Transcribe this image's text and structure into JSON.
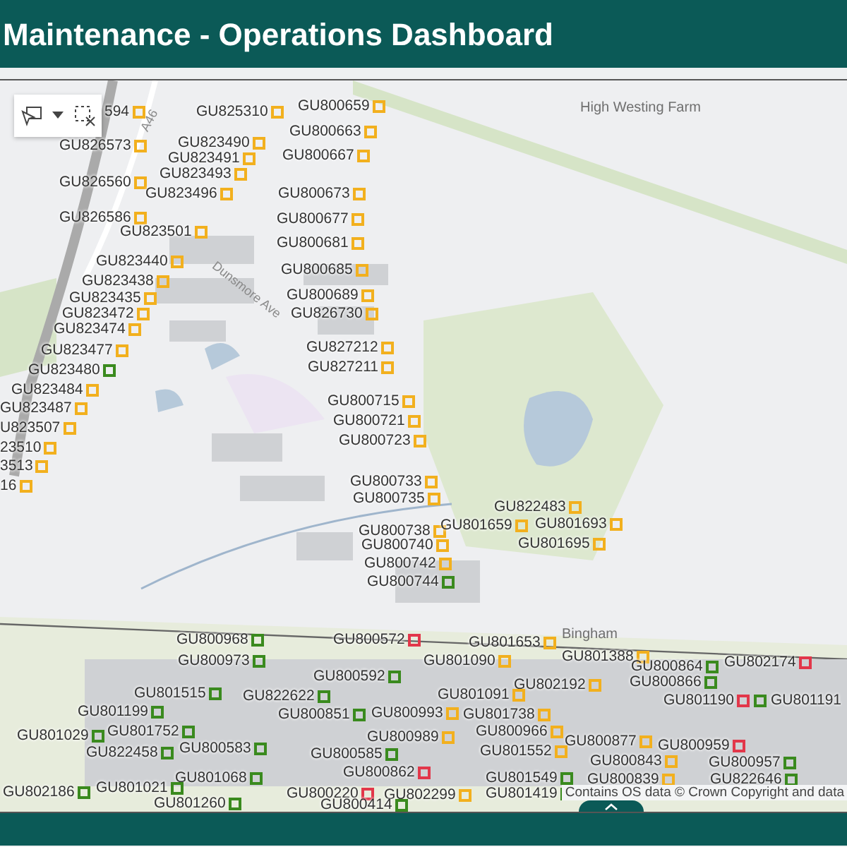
{
  "header": {
    "title": "Maintenance - Operations Dashboard"
  },
  "map": {
    "place_labels": [
      {
        "kind": "road",
        "text": "A46"
      },
      {
        "kind": "road",
        "text": "Dunsmore Ave"
      },
      {
        "kind": "place",
        "text": "High Westing Farm"
      },
      {
        "kind": "place",
        "text": "Bingham"
      }
    ],
    "labels": [
      {
        "text": "594",
        "color": "#f2b01e"
      },
      {
        "text": "GU825310",
        "color": "#f2b01e"
      },
      {
        "text": "GU800659",
        "color": "#f2b01e"
      },
      {
        "text": "GU826573",
        "color": "#f2b01e"
      },
      {
        "text": "GU823490",
        "color": "#f2b01e"
      },
      {
        "text": "GU800663",
        "color": "#f2b01e"
      },
      {
        "text": "GU823491",
        "color": "#f2b01e"
      },
      {
        "text": "GU800667",
        "color": "#f2b01e"
      },
      {
        "text": "GU823493",
        "color": "#f2b01e"
      },
      {
        "text": "GU826560",
        "color": "#f2b01e"
      },
      {
        "text": "GU823496",
        "color": "#f2b01e"
      },
      {
        "text": "GU800673",
        "color": "#f2b01e"
      },
      {
        "text": "GU826586",
        "color": "#f2b01e"
      },
      {
        "text": "GU800677",
        "color": "#f2b01e"
      },
      {
        "text": "GU823501",
        "color": "#f2b01e"
      },
      {
        "text": "GU800681",
        "color": "#f2b01e"
      },
      {
        "text": "GU823440",
        "color": "#f2b01e"
      },
      {
        "text": "GU800685",
        "color": "#f2b01e"
      },
      {
        "text": "GU823438",
        "color": "#f2b01e"
      },
      {
        "text": "GU823435",
        "color": "#f2b01e"
      },
      {
        "text": "GU800689",
        "color": "#f2b01e"
      },
      {
        "text": "GU823472",
        "color": "#f2b01e"
      },
      {
        "text": "GU826730",
        "color": "#f2b01e"
      },
      {
        "text": "GU823474",
        "color": "#f2b01e"
      },
      {
        "text": "GU827212",
        "color": "#f2b01e"
      },
      {
        "text": "GU823477",
        "color": "#f2b01e"
      },
      {
        "text": "GU823480",
        "color": "#3a8a1e"
      },
      {
        "text": "GU827211",
        "color": "#f2b01e"
      },
      {
        "text": "GU823484",
        "color": "#f2b01e"
      },
      {
        "text": "GU800715",
        "color": "#f2b01e"
      },
      {
        "text": "GU823487",
        "color": "#f2b01e"
      },
      {
        "text": "U823507",
        "color": "#f2b01e"
      },
      {
        "text": "GU800721",
        "color": "#f2b01e"
      },
      {
        "text": "23510",
        "color": "#f2b01e"
      },
      {
        "text": "GU800723",
        "color": "#f2b01e"
      },
      {
        "text": "3513",
        "color": "#f2b01e"
      },
      {
        "text": "16",
        "color": "#f2b01e"
      },
      {
        "text": "GU800733",
        "color": "#f2b01e"
      },
      {
        "text": "GU800735",
        "color": "#f2b01e"
      },
      {
        "text": "GU822483",
        "color": "#f2b01e"
      },
      {
        "text": "GU800738",
        "color": "#f2b01e"
      },
      {
        "text": "GU801659",
        "color": "#f2b01e"
      },
      {
        "text": "GU801693",
        "color": "#f2b01e"
      },
      {
        "text": "GU800740",
        "color": "#f2b01e"
      },
      {
        "text": "GU801695",
        "color": "#f2b01e"
      },
      {
        "text": "GU800742",
        "color": "#f2b01e"
      },
      {
        "text": "GU800744",
        "color": "#3a8a1e"
      },
      {
        "text": "GU800968",
        "color": "#3a8a1e"
      },
      {
        "text": "GU800572",
        "color": "#e2374a"
      },
      {
        "text": "GU801653",
        "color": "#f2b01e"
      },
      {
        "text": "GU800973",
        "color": "#3a8a1e"
      },
      {
        "text": "GU801090",
        "color": "#f2b01e"
      },
      {
        "text": "GU801388",
        "color": "#f2b01e"
      },
      {
        "text": "GU800864",
        "color": "#3a8a1e"
      },
      {
        "text": "GU802174",
        "color": "#e2374a"
      },
      {
        "text": "GU800592",
        "color": "#3a8a1e"
      },
      {
        "text": "GU802192",
        "color": "#f2b01e"
      },
      {
        "text": "GU800866",
        "color": "#3a8a1e"
      },
      {
        "text": "GU801515",
        "color": "#3a8a1e"
      },
      {
        "text": "GU822622",
        "color": "#3a8a1e"
      },
      {
        "text": "GU801091",
        "color": "#f2b01e"
      },
      {
        "text": "GU801190",
        "color": "#e2374a"
      },
      {
        "text": "GU801191",
        "color": "#3a8a1e"
      },
      {
        "text": "GU801199",
        "color": "#3a8a1e"
      },
      {
        "text": "GU800851",
        "color": "#3a8a1e"
      },
      {
        "text": "GU800993",
        "color": "#f2b01e"
      },
      {
        "text": "GU801738",
        "color": "#f2b01e"
      },
      {
        "text": "GU801029",
        "color": "#3a8a1e"
      },
      {
        "text": "GU801752",
        "color": "#3a8a1e"
      },
      {
        "text": "GU800989",
        "color": "#f2b01e"
      },
      {
        "text": "GU800966",
        "color": "#f2b01e"
      },
      {
        "text": "GU800877",
        "color": "#f2b01e"
      },
      {
        "text": "GU800959",
        "color": "#e2374a"
      },
      {
        "text": "GU822458",
        "color": "#3a8a1e"
      },
      {
        "text": "GU800583",
        "color": "#3a8a1e"
      },
      {
        "text": "GU800585",
        "color": "#3a8a1e"
      },
      {
        "text": "GU801552",
        "color": "#f2b01e"
      },
      {
        "text": "GU800843",
        "color": "#f2b01e"
      },
      {
        "text": "GU800957",
        "color": "#3a8a1e"
      },
      {
        "text": "GU801068",
        "color": "#3a8a1e"
      },
      {
        "text": "GU800862",
        "color": "#e2374a"
      },
      {
        "text": "GU801549",
        "color": "#3a8a1e"
      },
      {
        "text": "GU800839",
        "color": "#f2b01e"
      },
      {
        "text": "GU822646",
        "color": "#3a8a1e"
      },
      {
        "text": "GU802186",
        "color": "#3a8a1e"
      },
      {
        "text": "GU801021",
        "color": "#3a8a1e"
      },
      {
        "text": "GU800220",
        "color": "#e2374a"
      },
      {
        "text": "GU802299",
        "color": "#f2b01e"
      },
      {
        "text": "GU801419",
        "color": "#3a8a1e"
      },
      {
        "text": "GU801260",
        "color": "#3a8a1e"
      },
      {
        "text": "GU800414",
        "color": "#3a8a1e"
      }
    ],
    "attribution": "Contains OS data © Crown Copyright and data"
  }
}
